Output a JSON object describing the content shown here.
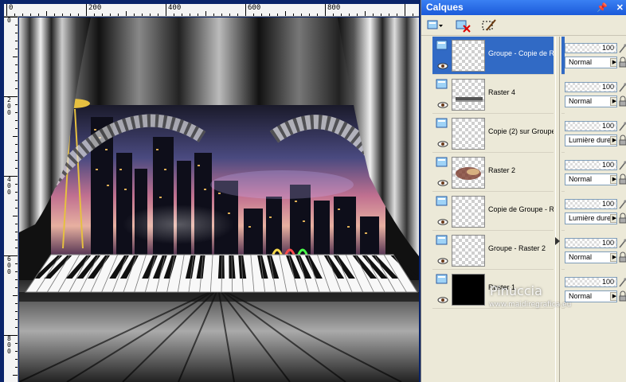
{
  "rulers": {
    "horizontal": [
      "0",
      "200",
      "400",
      "600",
      "800"
    ],
    "vertical": [
      "0",
      "200",
      "400",
      "600",
      "800"
    ]
  },
  "palette": {
    "title": "Calques",
    "title_buttons": [
      "pin-icon",
      "close-icon"
    ],
    "toolbar": [
      "new-layer-icon",
      "delete-layer-icon",
      "mask-icon"
    ]
  },
  "layers": [
    {
      "name": "Groupe - Copie de R",
      "selected": true,
      "opacity": "100",
      "blend": "Normal"
    },
    {
      "name": "Raster 4",
      "selected": false,
      "opacity": "100",
      "blend": "Normal"
    },
    {
      "name": "Copie (2) sur Groupe",
      "selected": false,
      "opacity": "100",
      "blend": "Lumière dure"
    },
    {
      "name": "Raster 2",
      "selected": false,
      "opacity": "100",
      "blend": "Normal"
    },
    {
      "name": "Copie de Groupe - R",
      "selected": false,
      "opacity": "100",
      "blend": "Lumière dure"
    },
    {
      "name": "Groupe - Raster 2",
      "selected": false,
      "opacity": "100",
      "blend": "Normal"
    },
    {
      "name": "Raster 1",
      "selected": false,
      "opacity": "100",
      "blend": "Normal"
    }
  ],
  "watermark": {
    "brand": "Pinuccia",
    "url": "www.maidiregrafica.eu"
  },
  "colors": {
    "selection": "#316ac5",
    "panel": "#ece9d8",
    "titlebar": "#1b5ad9"
  }
}
